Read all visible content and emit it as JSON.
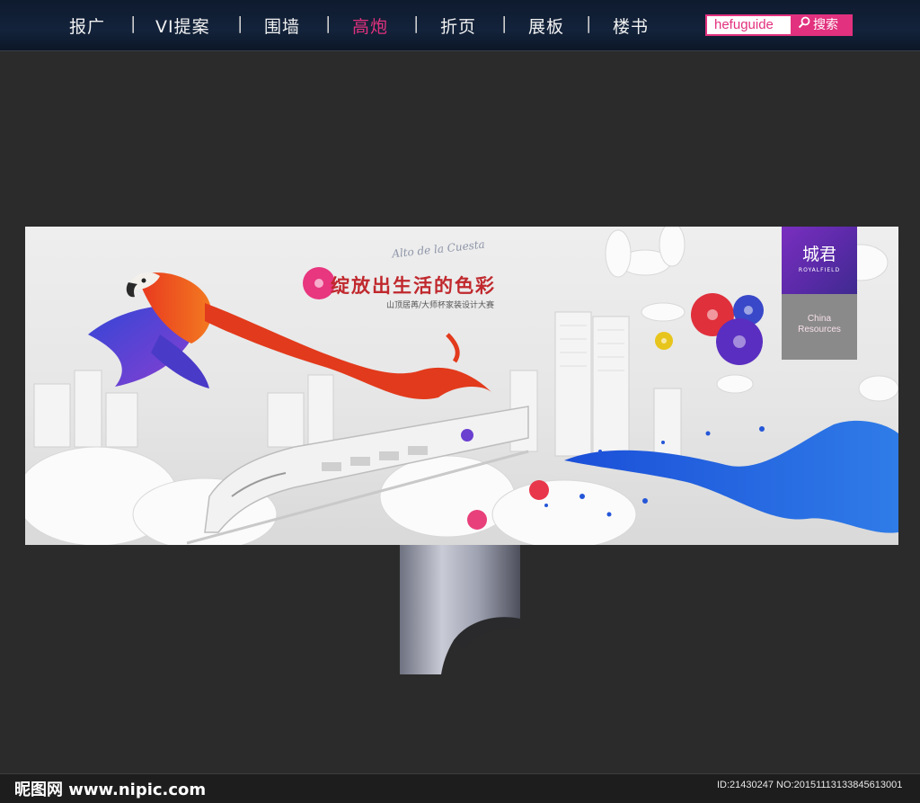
{
  "nav": {
    "items": [
      {
        "label": "报广",
        "active": false
      },
      {
        "label": "VI提案",
        "active": false
      },
      {
        "label": "围墙",
        "active": false
      },
      {
        "label": "高炮",
        "active": true
      },
      {
        "label": "折页",
        "active": false
      },
      {
        "label": "展板",
        "active": false
      },
      {
        "label": "楼书",
        "active": false
      }
    ],
    "separator": "|"
  },
  "search": {
    "value": "hefuguide",
    "button_label": "搜索"
  },
  "billboard": {
    "script_text": "Alto de la Cuesta",
    "headline": "绽放出生活的色彩",
    "subhead": "山顶居苒/大师杯家装设计大赛",
    "brand_logo": "城君",
    "brand_sub": "ROYALFIELD",
    "brand_en_1": "China",
    "brand_en_2": "Resources"
  },
  "watermark": {
    "site": "昵图网 www.nipic.com",
    "id_text": "ID:21430247 NO:20151113133845613001"
  },
  "colors": {
    "accent": "#e2317e",
    "nav_bg": "#13233b",
    "page_bg": "#2b2b2b",
    "headline": "#c0282d",
    "brand_purple": "#5a2aa8"
  }
}
